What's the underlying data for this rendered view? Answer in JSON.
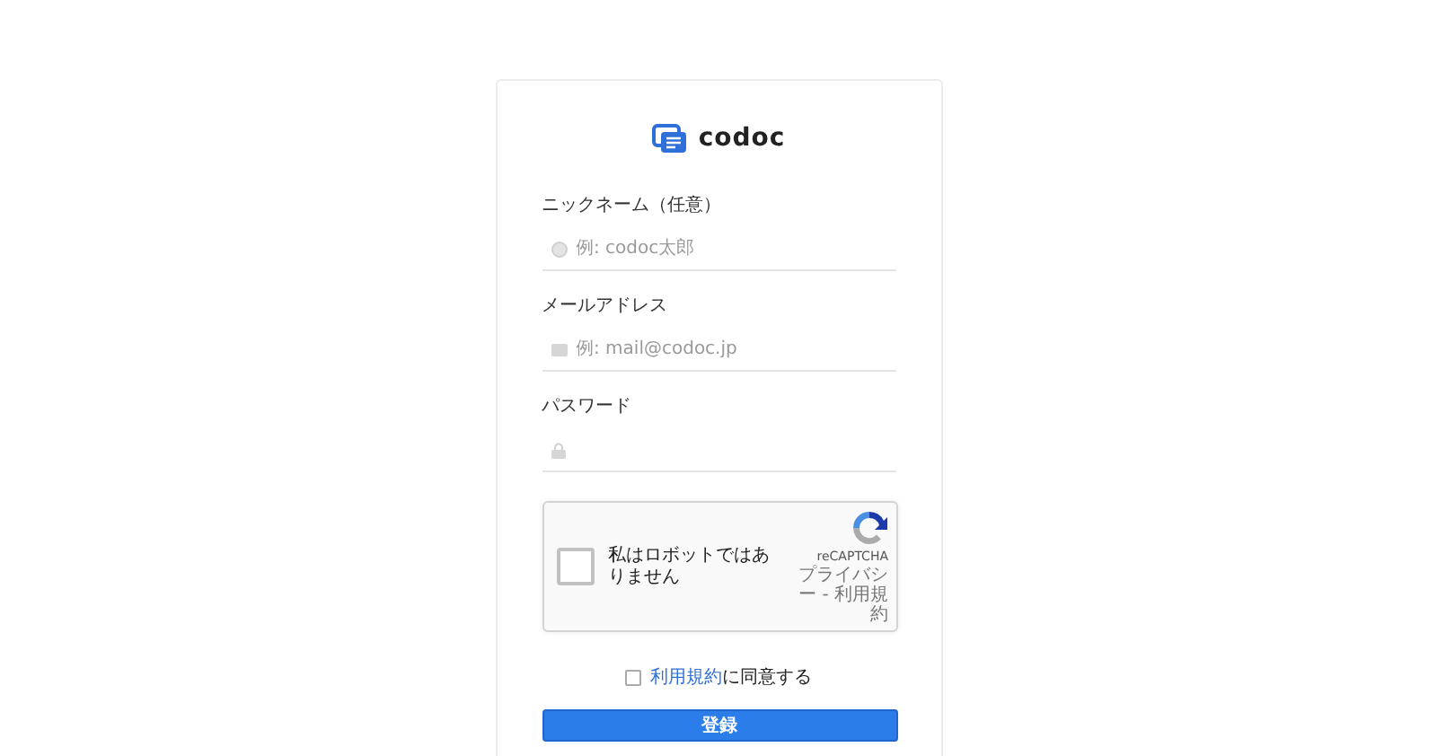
{
  "logo": {
    "text": "codoc"
  },
  "fields": [
    {
      "label": "ニックネーム（任意）",
      "placeholder": "例: codoc太郎",
      "kind": "person"
    },
    {
      "label": "メールアドレス",
      "placeholder": "例: mail@codoc.jp",
      "kind": "mail"
    },
    {
      "label": "パスワード",
      "kind": "lock"
    }
  ],
  "captcha": {
    "label": "私はロボットではありません",
    "checked": false,
    "brand": "reCAPTCHA",
    "links": "プライバシー - 利用規約"
  },
  "terms": {
    "checked": false,
    "link": "利用規約",
    "text": "に同意する"
  },
  "submit": {
    "label": "登録"
  }
}
